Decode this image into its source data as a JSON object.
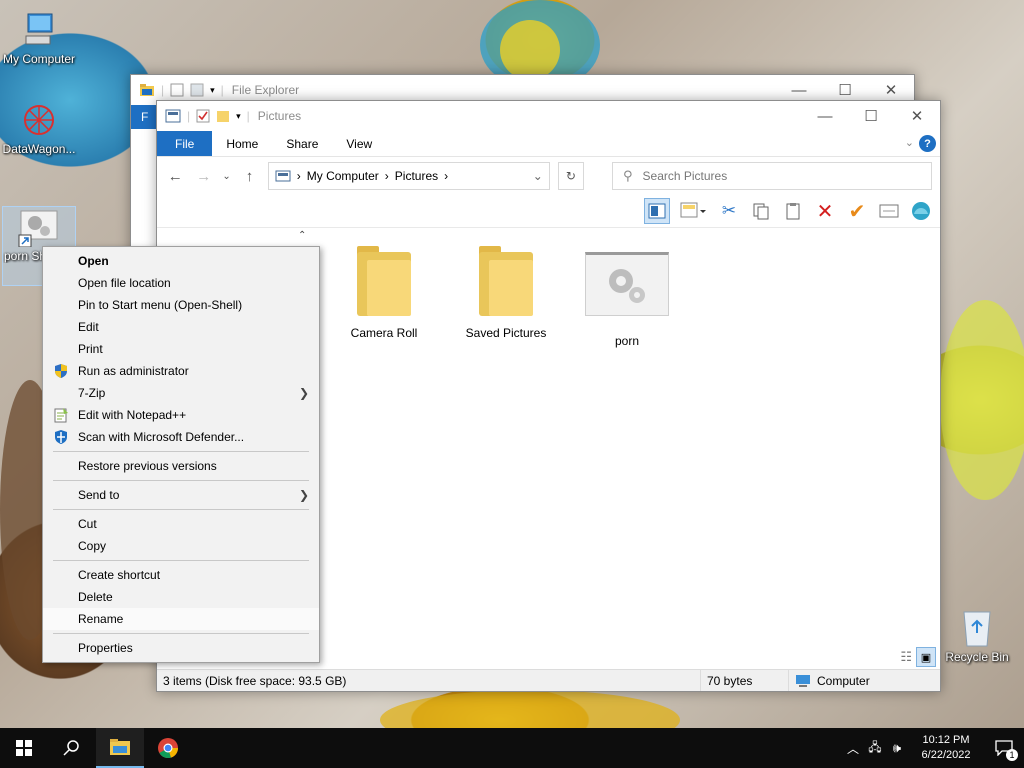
{
  "desktop": {
    "icons": [
      {
        "label": "My Computer"
      },
      {
        "label": "DataWagon..."
      },
      {
        "label": "porn Shortcut"
      },
      {
        "label": "Recycle Bin"
      }
    ]
  },
  "explorer_back": {
    "title": "File Explorer",
    "file_tab": "F"
  },
  "explorer": {
    "title": "Pictures",
    "tabs": [
      {
        "label": "File"
      },
      {
        "label": "Home"
      },
      {
        "label": "Share"
      },
      {
        "label": "View"
      }
    ],
    "breadcrumb": [
      "My Computer",
      "Pictures"
    ],
    "search_placeholder": "Search Pictures",
    "items": [
      {
        "label": "Camera Roll",
        "kind": "folder"
      },
      {
        "label": "Saved Pictures",
        "kind": "folder"
      },
      {
        "label": "porn",
        "kind": "shortcut"
      }
    ],
    "status": {
      "summary": "3 items (Disk free space: 93.5 GB)",
      "size": "70 bytes",
      "location": "Computer"
    }
  },
  "context_menu": {
    "items": [
      {
        "label": "Open",
        "bold": true
      },
      {
        "label": "Open file location"
      },
      {
        "label": "Pin to Start menu (Open-Shell)"
      },
      {
        "label": "Edit"
      },
      {
        "label": "Print"
      },
      {
        "label": "Run as administrator",
        "icon": "shield-icon"
      },
      {
        "label": "7-Zip",
        "submenu": true
      },
      {
        "label": "Edit with Notepad++",
        "icon": "notepad-icon"
      },
      {
        "label": "Scan with Microsoft Defender...",
        "icon": "defender-icon"
      },
      {
        "label": "Restore previous versions"
      },
      {
        "label": "Send to",
        "submenu": true
      },
      {
        "label": "Cut"
      },
      {
        "label": "Copy"
      },
      {
        "label": "Create shortcut"
      },
      {
        "label": "Delete"
      },
      {
        "label": "Rename"
      },
      {
        "label": "Properties"
      }
    ]
  },
  "taskbar": {
    "time": "10:12 PM",
    "date": "6/22/2022",
    "notification_count": "1"
  },
  "colors": {
    "accent": "#1e6fc3",
    "taskbar": "#0d0d0d"
  }
}
